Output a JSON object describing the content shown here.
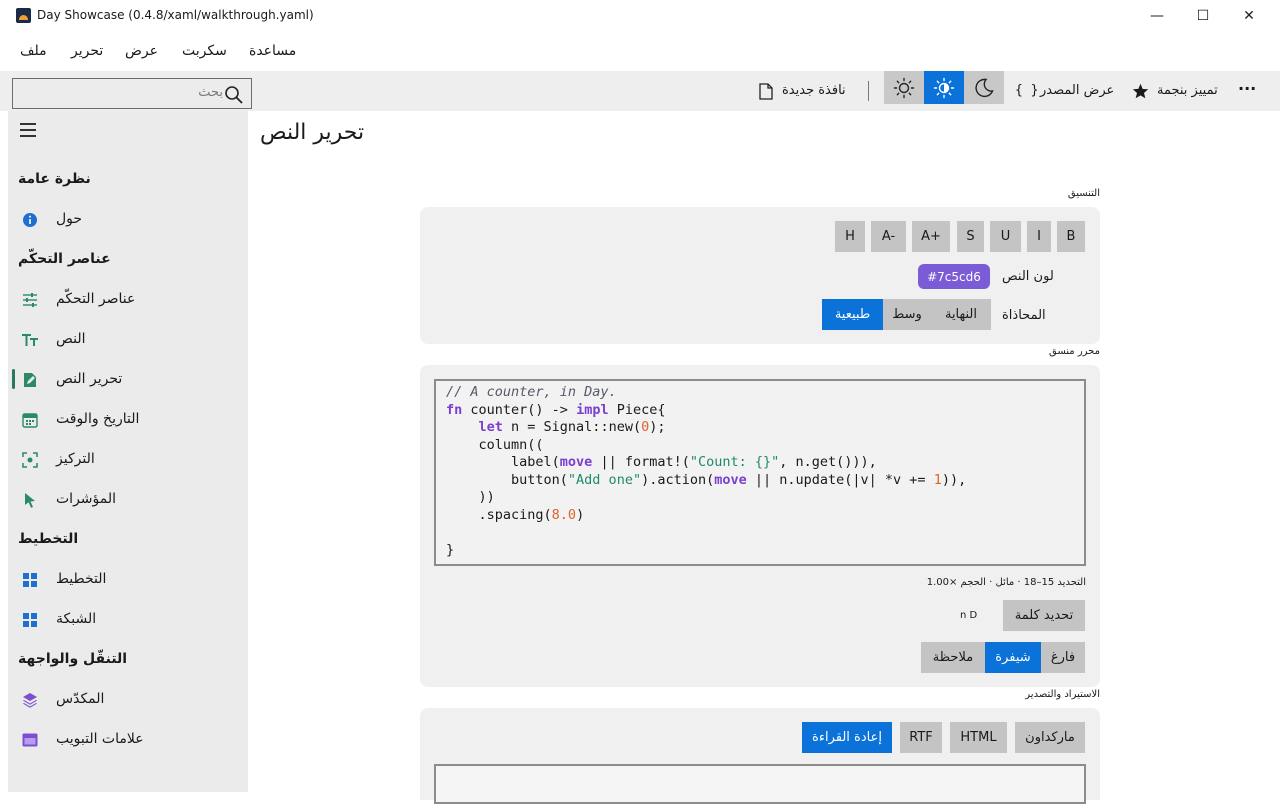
{
  "window": {
    "title": "Day Showcase (0.4.8/xaml/walkthrough.yaml)",
    "minimize": "—",
    "maximize": "☐",
    "close": "✕"
  },
  "menu": [
    "ملف",
    "تحرير",
    "عرض",
    "سكربت",
    "مساعدة"
  ],
  "toolbar": {
    "search_placeholder": "بحث",
    "new_window": "نافذة جديدة",
    "view_source": "عرض المصدر",
    "view_source_glyph": "{ }",
    "star_mark": "تمييز بنجمة",
    "more": "···"
  },
  "sidebar": {
    "groups": [
      {
        "header": "نظرة عامة",
        "items": [
          {
            "label": "حول",
            "icon": "info-icon"
          }
        ]
      },
      {
        "header": "عناصر التحكّم",
        "items": [
          {
            "label": "عناصر التحكّم",
            "icon": "sliders-icon"
          },
          {
            "label": "النص",
            "icon": "text-size-icon"
          },
          {
            "label": "تحرير النص",
            "icon": "edit-document-icon",
            "active": true
          },
          {
            "label": "التاريخ والوقت",
            "icon": "calendar-icon"
          },
          {
            "label": "التركيز",
            "icon": "focus-icon"
          },
          {
            "label": "المؤشرات",
            "icon": "pointer-icon"
          }
        ]
      },
      {
        "header": "التخطيط",
        "items": [
          {
            "label": "التخطيط",
            "icon": "layout-grid-icon"
          },
          {
            "label": "الشبكة",
            "icon": "grid-icon"
          }
        ]
      },
      {
        "header": "التنقّل والواجهة",
        "items": [
          {
            "label": "المكدّس",
            "icon": "layers-icon"
          },
          {
            "label": "علامات التبويب",
            "icon": "tabs-icon"
          }
        ]
      }
    ]
  },
  "page": {
    "title": "تحرير النص",
    "formatting": {
      "section_label": "التنسيق",
      "buttons": [
        "H",
        "A-",
        "A+",
        "S",
        "U",
        "I",
        "B"
      ],
      "text_color_label": "لون النص",
      "text_color_value": "#7c5cd6",
      "alignment_label": "المحاذاة",
      "alignment_options": [
        "طبيعية",
        "وسط",
        "النهاية"
      ],
      "alignment_selected": "طبيعية"
    },
    "rich_editor": {
      "section_label": "محرر منسق",
      "code": "// A counter, in Day.\nfn counter() -> impl Piece{\n    let n = Signal::new(0);\n    column((\n        label(move || format!(\"Count: {}\", n.get())),\n        button(\"Add one\").action(move || n.update(|v| *v += 1)),\n    ))\n    .spacing(8.0)\n\n}",
      "status": "التحديد 15–18 · مائل · الحجم ×1.00",
      "select_word": "تحديد كلمة",
      "select_word_result": "n D",
      "modes": [
        "ملاحظة",
        "شيفرة",
        "فارغ"
      ],
      "mode_selected": "شيفرة"
    },
    "import_export": {
      "section_label": "الاستيراد والتصدير",
      "buttons": [
        "إعادة القراءة",
        "RTF",
        "HTML",
        "ماركداون"
      ]
    }
  },
  "colors": {
    "accent": "#0a72d8",
    "text_color_swatch": "#7c5cd6",
    "sidebar_icon_green": "#2a8a66",
    "sidebar_icon_blue": "#1f6fd0",
    "sidebar_icon_purple": "#7c4fd0"
  }
}
